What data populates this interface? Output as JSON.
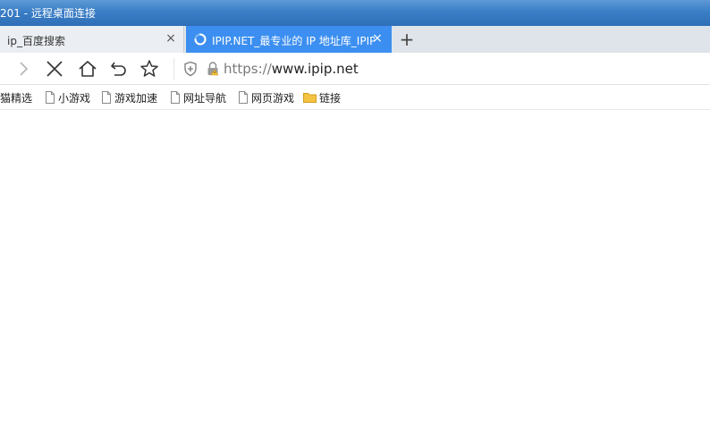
{
  "window": {
    "title": "201 - 远程桌面连接"
  },
  "tabs": [
    {
      "title": "ip_百度搜索",
      "close": "×",
      "active": false
    },
    {
      "title": "IPIP.NET_最专业的 IP 地址库_IPIP",
      "close": "×",
      "active": true,
      "loading": true
    }
  ],
  "new_tab_label": "+",
  "address_bar": {
    "scheme": "https://",
    "host": "www.ipip.net"
  },
  "bookmarks": [
    {
      "label": "猫精选",
      "icon": "none"
    },
    {
      "label": "小游戏",
      "icon": "page-icon"
    },
    {
      "label": "游戏加速",
      "icon": "page-icon"
    },
    {
      "label": "网址导航",
      "icon": "page-icon"
    },
    {
      "label": "网页游戏",
      "icon": "page-icon"
    },
    {
      "label": "链接",
      "icon": "folder-icon"
    }
  ],
  "colors": {
    "titlebar": "#3a7ec6",
    "active_tab": "#3c8ff0",
    "folder": "#f5c342"
  }
}
